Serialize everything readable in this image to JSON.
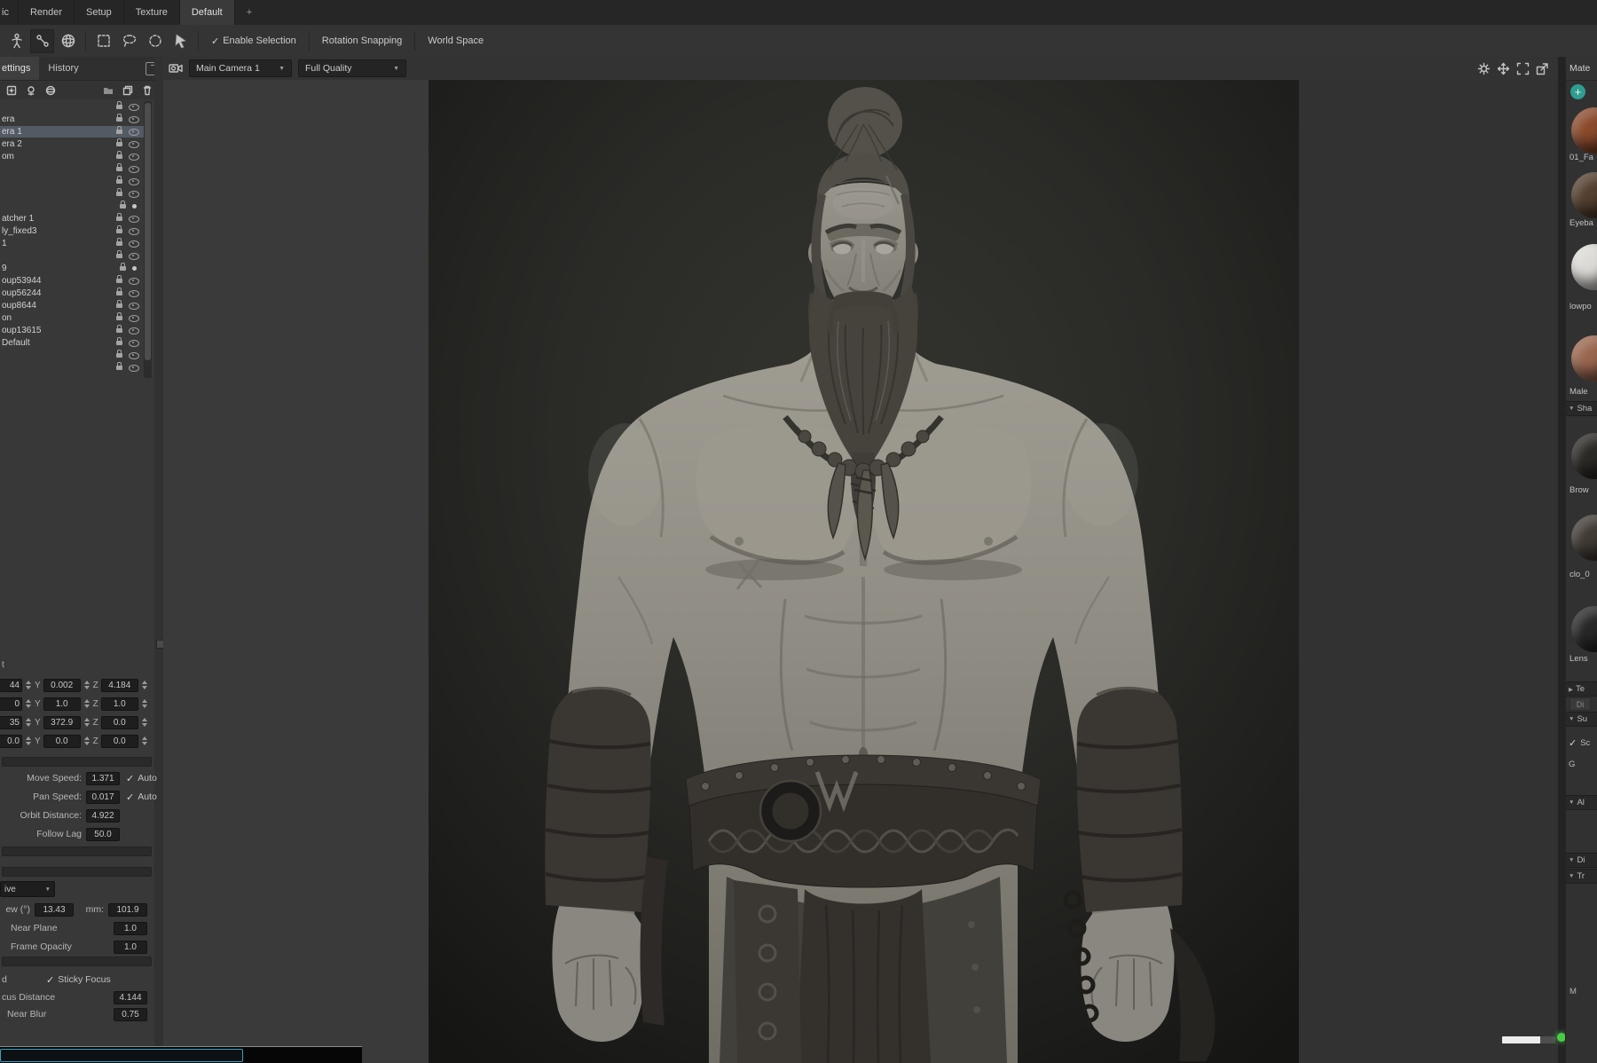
{
  "app": {
    "accent_teal": "#3aa0bf",
    "status_green": "#48cc48"
  },
  "menubar": {
    "tabs": [
      {
        "label": "ic"
      },
      {
        "label": "Render"
      },
      {
        "label": "Setup"
      },
      {
        "label": "Texture"
      },
      {
        "label": "Default",
        "active": true
      }
    ],
    "add_tab": "+"
  },
  "toolbar": {
    "enable_selection": "Enable Selection",
    "rotation_snapping": "Rotation Snapping",
    "world_space": "World Space"
  },
  "left_panel": {
    "tabs": {
      "settings": "ettings",
      "history": "History"
    },
    "outliner": {
      "rows": [
        {
          "label": ""
        },
        {
          "label": "era"
        },
        {
          "label": "era 1",
          "selected": true
        },
        {
          "label": "era 2"
        },
        {
          "label": "om"
        },
        {
          "label": ""
        },
        {
          "label": ""
        },
        {
          "label": ""
        },
        {
          "label": "",
          "dot": true
        },
        {
          "label": "atcher 1"
        },
        {
          "label": "ly_fixed3"
        },
        {
          "label": "1"
        },
        {
          "label": ""
        },
        {
          "label": "9",
          "dot": true
        },
        {
          "label": "oup53944"
        },
        {
          "label": "oup56244"
        },
        {
          "label": "oup8644"
        },
        {
          "label": "on"
        },
        {
          "label": "oup13615"
        },
        {
          "label": "Default"
        },
        {
          "label": ""
        },
        {
          "label": ""
        }
      ]
    },
    "transform": {
      "partial_label": "t",
      "axis_y": "Y",
      "axis_z": "Z",
      "rows": [
        {
          "x": "44",
          "y": "0.002",
          "z": "4.184"
        },
        {
          "x": "0",
          "y": "1.0",
          "z": "1.0"
        },
        {
          "x": "35",
          "y": "372.9",
          "z": "0.0"
        },
        {
          "x": "0.0",
          "y": "0.0",
          "z": "0.0"
        }
      ]
    },
    "camera_motion": {
      "move_speed_label": "Move Speed:",
      "move_speed": "1.371",
      "auto_label": "Auto",
      "pan_speed_label": "Pan Speed:",
      "pan_speed": "0.017",
      "orbit_label": "Orbit Distance:",
      "orbit_distance": "4.922",
      "follow_label": "Follow Lag",
      "follow_lag": "50.0"
    },
    "lens": {
      "projection_value": "ive",
      "fov_label": "ew (°)",
      "fov": "13.43",
      "mm_label": "mm:",
      "mm": "101.9",
      "near_plane_label": "Near Plane",
      "near_plane": "1.0",
      "frame_opacity_label": "Frame Opacity",
      "frame_opacity": "1.0",
      "enabled_partial": "d",
      "sticky_focus_label": "Sticky Focus",
      "focus_distance_label": "cus Distance",
      "focus_distance": "4.144",
      "near_blur_label": "Near Blur",
      "near_blur": "0.75"
    }
  },
  "viewport": {
    "camera_select": "Main Camera 1",
    "quality_select": "Full Quality",
    "progress_pct": 72
  },
  "materials_panel": {
    "title": "Mate",
    "add_label": "+",
    "swatches": [
      {
        "label": "01_Fa",
        "color": "#8a4a2c"
      },
      {
        "label": "Eyeba",
        "color": "#54402f"
      },
      {
        "label": "lowpo",
        "color": "#dcdad6"
      },
      {
        "label": "Male",
        "color": "#99664e"
      },
      {
        "label": "Brow",
        "color": "#2c2a27"
      },
      {
        "label": "clo_0",
        "color": "#413b35"
      },
      {
        "label": "Lens",
        "color": "#282828"
      }
    ],
    "sections": {
      "shader": "Sha",
      "texture": "Te",
      "disabled_button": "Di",
      "subsurface": "Su",
      "scatter": "Sc",
      "gloss": "G",
      "albedo": "Al",
      "displacement": "Di",
      "transparency": "Tr",
      "m_partial": "M"
    }
  }
}
